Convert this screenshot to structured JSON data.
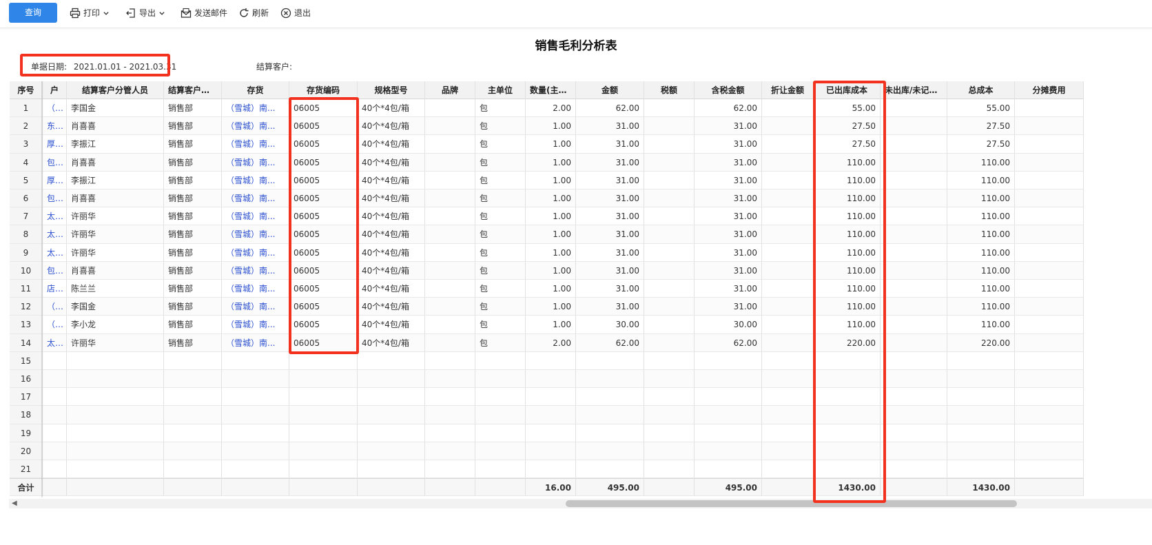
{
  "toolbar": {
    "query_label": "查询",
    "print_label": "打印",
    "export_label": "导出",
    "email_label": "发送邮件",
    "refresh_label": "刷新",
    "exit_label": "退出"
  },
  "report": {
    "title": "销售毛利分析表",
    "date_label": "单据日期:",
    "date_range": "2021.01.01 - 2021.03.31",
    "customer_label": "结算客户:",
    "customer_value": ""
  },
  "table": {
    "columns": [
      "序号",
      "户",
      "结算客户分管人员",
      "结算客户分管部门",
      "存货",
      "存货编码",
      "规格型号",
      "品牌",
      "主单位",
      "数量(主单位)",
      "金额",
      "税额",
      "含税金额",
      "折让金额",
      "已出库成本",
      "未出库/未记账成本",
      "总成本",
      "分摊费用"
    ],
    "rows": [
      [
        "1",
        "（...",
        "李国金",
        "销售部",
        "（雪城）南...",
        "06005",
        "40个*4包/箱",
        "",
        "包",
        "2.00",
        "62.00",
        "",
        "62.00",
        "",
        "55.00",
        "",
        "55.00",
        ""
      ],
      [
        "2",
        "东...",
        "肖喜喜",
        "销售部",
        "（雪城）南...",
        "06005",
        "40个*4包/箱",
        "",
        "包",
        "1.00",
        "31.00",
        "",
        "31.00",
        "",
        "27.50",
        "",
        "27.50",
        ""
      ],
      [
        "3",
        "厚...",
        "李振江",
        "销售部",
        "（雪城）南...",
        "06005",
        "40个*4包/箱",
        "",
        "包",
        "1.00",
        "31.00",
        "",
        "31.00",
        "",
        "27.50",
        "",
        "27.50",
        ""
      ],
      [
        "4",
        "包...",
        "肖喜喜",
        "销售部",
        "（雪城）南...",
        "06005",
        "40个*4包/箱",
        "",
        "包",
        "1.00",
        "31.00",
        "",
        "31.00",
        "",
        "110.00",
        "",
        "110.00",
        ""
      ],
      [
        "5",
        "厚...",
        "李振江",
        "销售部",
        "（雪城）南...",
        "06005",
        "40个*4包/箱",
        "",
        "包",
        "1.00",
        "31.00",
        "",
        "31.00",
        "",
        "110.00",
        "",
        "110.00",
        ""
      ],
      [
        "6",
        "包...",
        "肖喜喜",
        "销售部",
        "（雪城）南...",
        "06005",
        "40个*4包/箱",
        "",
        "包",
        "1.00",
        "31.00",
        "",
        "31.00",
        "",
        "110.00",
        "",
        "110.00",
        ""
      ],
      [
        "7",
        "太...",
        "许丽华",
        "销售部",
        "（雪城）南...",
        "06005",
        "40个*4包/箱",
        "",
        "包",
        "1.00",
        "31.00",
        "",
        "31.00",
        "",
        "110.00",
        "",
        "110.00",
        ""
      ],
      [
        "8",
        "太...",
        "许丽华",
        "销售部",
        "（雪城）南...",
        "06005",
        "40个*4包/箱",
        "",
        "包",
        "1.00",
        "31.00",
        "",
        "31.00",
        "",
        "110.00",
        "",
        "110.00",
        ""
      ],
      [
        "9",
        "太...",
        "许丽华",
        "销售部",
        "（雪城）南...",
        "06005",
        "40个*4包/箱",
        "",
        "包",
        "1.00",
        "31.00",
        "",
        "31.00",
        "",
        "110.00",
        "",
        "110.00",
        ""
      ],
      [
        "10",
        "包...",
        "肖喜喜",
        "销售部",
        "（雪城）南...",
        "06005",
        "40个*4包/箱",
        "",
        "包",
        "1.00",
        "31.00",
        "",
        "31.00",
        "",
        "110.00",
        "",
        "110.00",
        ""
      ],
      [
        "11",
        "店...",
        "陈兰兰",
        "销售部",
        "（雪城）南...",
        "06005",
        "40个*4包/箱",
        "",
        "包",
        "1.00",
        "31.00",
        "",
        "31.00",
        "",
        "110.00",
        "",
        "110.00",
        ""
      ],
      [
        "12",
        "（...",
        "李国金",
        "销售部",
        "（雪城）南...",
        "06005",
        "40个*4包/箱",
        "",
        "包",
        "1.00",
        "31.00",
        "",
        "31.00",
        "",
        "110.00",
        "",
        "110.00",
        ""
      ],
      [
        "13",
        "（...",
        "李小龙",
        "销售部",
        "（雪城）南...",
        "06005",
        "40个*4包/箱",
        "",
        "包",
        "1.00",
        "30.00",
        "",
        "30.00",
        "",
        "110.00",
        "",
        "110.00",
        ""
      ],
      [
        "14",
        "太...",
        "许丽华",
        "销售部",
        "（雪城）南...",
        "06005",
        "40个*4包/箱",
        "",
        "包",
        "2.00",
        "62.00",
        "",
        "62.00",
        "",
        "220.00",
        "",
        "220.00",
        ""
      ],
      [
        "15",
        "",
        "",
        "",
        "",
        "",
        "",
        "",
        "",
        "",
        "",
        "",
        "",
        "",
        "",
        "",
        "",
        ""
      ],
      [
        "16",
        "",
        "",
        "",
        "",
        "",
        "",
        "",
        "",
        "",
        "",
        "",
        "",
        "",
        "",
        "",
        "",
        ""
      ],
      [
        "17",
        "",
        "",
        "",
        "",
        "",
        "",
        "",
        "",
        "",
        "",
        "",
        "",
        "",
        "",
        "",
        "",
        ""
      ],
      [
        "18",
        "",
        "",
        "",
        "",
        "",
        "",
        "",
        "",
        "",
        "",
        "",
        "",
        "",
        "",
        "",
        "",
        ""
      ],
      [
        "19",
        "",
        "",
        "",
        "",
        "",
        "",
        "",
        "",
        "",
        "",
        "",
        "",
        "",
        "",
        "",
        "",
        ""
      ],
      [
        "20",
        "",
        "",
        "",
        "",
        "",
        "",
        "",
        "",
        "",
        "",
        "",
        "",
        "",
        "",
        "",
        "",
        ""
      ],
      [
        "21",
        "",
        "",
        "",
        "",
        "",
        "",
        "",
        "",
        "",
        "",
        "",
        "",
        "",
        "",
        "",
        "",
        ""
      ]
    ],
    "totals": [
      "合计",
      "",
      "",
      "",
      "",
      "",
      "",
      "",
      "",
      "16.00",
      "495.00",
      "",
      "495.00",
      "",
      "1430.00",
      "",
      "1430.00",
      ""
    ]
  }
}
